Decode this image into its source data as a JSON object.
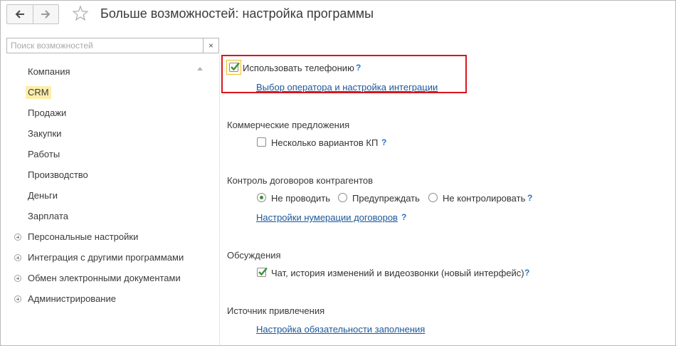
{
  "header": {
    "title": "Больше возможностей: настройка программы",
    "back_icon": "arrow-left-icon",
    "forward_icon": "arrow-right-icon",
    "favorite_icon": "star-icon"
  },
  "search": {
    "placeholder": "Поиск возможностей",
    "value": "",
    "clear_label": "×"
  },
  "sidebar": {
    "items": [
      {
        "label": "Компания"
      },
      {
        "label": "CRM",
        "selected": true
      },
      {
        "label": "Продажи"
      },
      {
        "label": "Закупки"
      },
      {
        "label": "Работы"
      },
      {
        "label": "Производство"
      },
      {
        "label": "Деньги"
      },
      {
        "label": "Зарплата"
      },
      {
        "label": "Персональные настройки",
        "expandable": true
      },
      {
        "label": "Интеграция с другими программами",
        "expandable": true
      },
      {
        "label": "Обмен электронными документами",
        "expandable": true
      },
      {
        "label": "Администрирование",
        "expandable": true
      }
    ]
  },
  "main": {
    "telephony": {
      "checkbox_label": "Использовать телефонию",
      "checked": true,
      "help": "?",
      "link": "Выбор оператора и настройка интеграции"
    },
    "commercial": {
      "title": "Коммерческие предложения",
      "checkbox_label": "Несколько вариантов КП",
      "checked": false,
      "help": "?"
    },
    "contracts": {
      "title": "Контроль договоров контрагентов",
      "options": [
        "Не проводить",
        "Предупреждать",
        "Не контролировать"
      ],
      "selected": "Не проводить",
      "help": "?",
      "link": "Настройки нумерации договоров",
      "link_help": "?"
    },
    "discussions": {
      "title": "Обсуждения",
      "checkbox_label": "Чат, история изменений и видеозвонки (новый интерфейс)",
      "checked": true,
      "help": "?"
    },
    "source": {
      "title": "Источник привлечения",
      "link": "Настройка обязательности заполнения"
    }
  },
  "colors": {
    "highlight_border": "#d8171d",
    "selected_item_bg": "#fdeeaa",
    "link": "#1a5799",
    "help": "#2b73c2",
    "check": "#3c8f3c"
  }
}
